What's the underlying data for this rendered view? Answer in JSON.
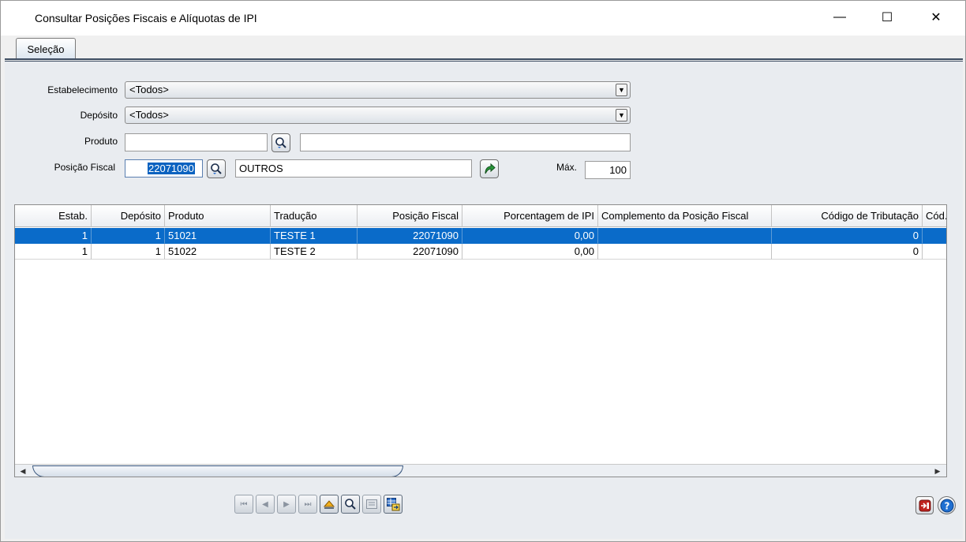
{
  "window": {
    "title": "Consultar Posições Fiscais e Alíquotas de IPI",
    "minimize": "—",
    "maximize": "☐",
    "close": "✕"
  },
  "tabs": [
    {
      "label": "Seleção",
      "active": true
    }
  ],
  "form": {
    "estabelecimento": {
      "label": "Estabelecimento",
      "value": "<Todos>"
    },
    "deposito": {
      "label": "Depósito",
      "value": "<Todos>"
    },
    "produto": {
      "label": "Produto",
      "code": "",
      "description": ""
    },
    "posicao_fiscal": {
      "label": "Posição Fiscal",
      "code": "22071090",
      "description": "OUTROS"
    },
    "max": {
      "label": "Máx.",
      "value": "100"
    }
  },
  "grid": {
    "columns": [
      "Estab.",
      "Depósito",
      "Produto",
      "Tradução",
      "Posição Fiscal",
      "Porcentagem de IPI",
      "Complemento da Posição Fiscal",
      "Código de Tributação",
      "Cód. F"
    ],
    "rows": [
      {
        "estab": "1",
        "deposito": "1",
        "produto": "51021",
        "traducao": "TESTE 1",
        "posicao_fiscal": "22071090",
        "ipi": "0,00",
        "complemento": "",
        "cod_trib": "0",
        "selected": true
      },
      {
        "estab": "1",
        "deposito": "1",
        "produto": "51022",
        "traducao": "TESTE 2",
        "posicao_fiscal": "22071090",
        "ipi": "0,00",
        "complemento": "",
        "cod_trib": "0",
        "selected": false
      }
    ]
  },
  "colors": {
    "selection": "#0a6bc9",
    "tab_line": "#3c4b60",
    "panel": "#e9ecf0"
  },
  "icons": {
    "search": "magnifier-icon",
    "execute": "green-arrow-icon",
    "exit": "exit-icon",
    "help": "help-icon"
  }
}
